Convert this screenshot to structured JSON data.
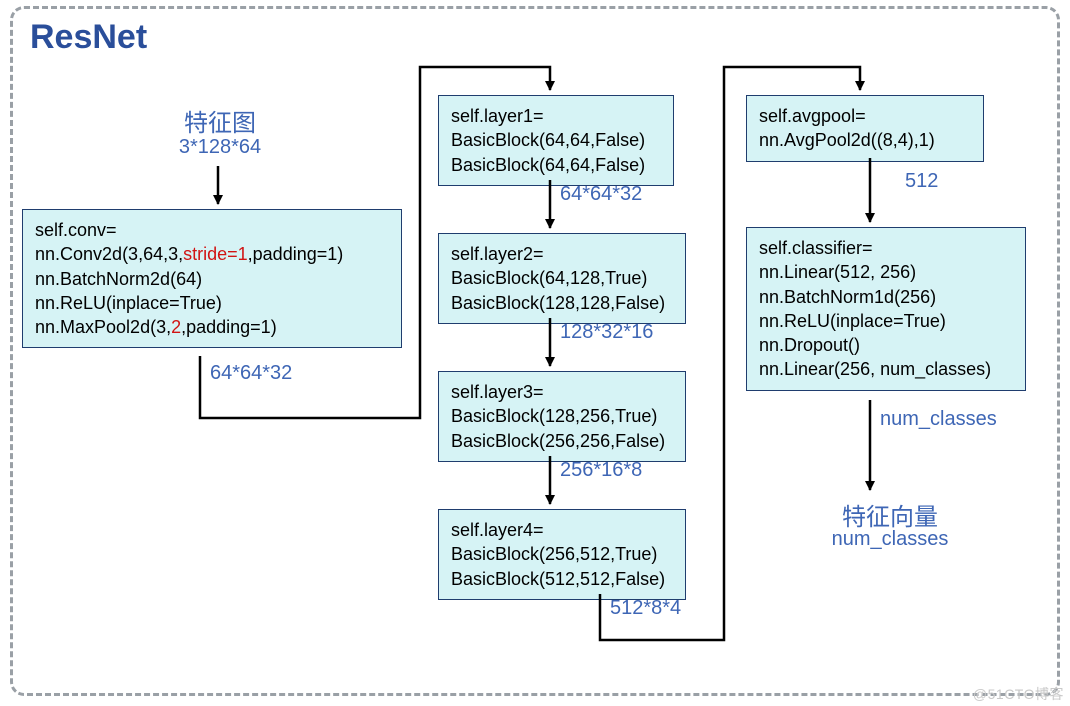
{
  "title": "ResNet",
  "input": {
    "label": "特征图",
    "shape": "3*128*64"
  },
  "conv": {
    "line1": "self.conv=",
    "line2a": "nn.Conv2d(3,64,3,",
    "line2b": "stride=1",
    "line2c": ",padding=1)",
    "line3": "nn.BatchNorm2d(64)",
    "line4": "nn.ReLU(inplace=True)",
    "line5a": "nn.MaxPool2d(3,",
    "line5b": "2",
    "line5c": ",padding=1)",
    "out": "64*64*32"
  },
  "layer1": {
    "line1": "self.layer1=",
    "line2": "BasicBlock(64,64,False)",
    "line3": "BasicBlock(64,64,False)",
    "out": "64*64*32"
  },
  "layer2": {
    "line1": "self.layer2=",
    "line2": "BasicBlock(64,128,True)",
    "line3": "BasicBlock(128,128,False)",
    "out": "128*32*16"
  },
  "layer3": {
    "line1": "self.layer3=",
    "line2": "BasicBlock(128,256,True)",
    "line3": "BasicBlock(256,256,False)",
    "out": "256*16*8"
  },
  "layer4": {
    "line1": "self.layer4=",
    "line2": "BasicBlock(256,512,True)",
    "line3": "BasicBlock(512,512,False)",
    "out": "512*8*4"
  },
  "avgpool": {
    "line1": "self.avgpool=",
    "line2": "nn.AvgPool2d((8,4),1)",
    "out": "512"
  },
  "classifier": {
    "line1": "self.classifier=",
    "line2": "nn.Linear(512, 256)",
    "line3": "nn.BatchNorm1d(256)",
    "line4": "nn.ReLU(inplace=True)",
    "line5": "nn.Dropout()",
    "line6": "nn.Linear(256, num_classes)",
    "out": "num_classes"
  },
  "output": {
    "label": "特征向量",
    "shape": "num_classes"
  },
  "watermark": "@51CTO博客"
}
